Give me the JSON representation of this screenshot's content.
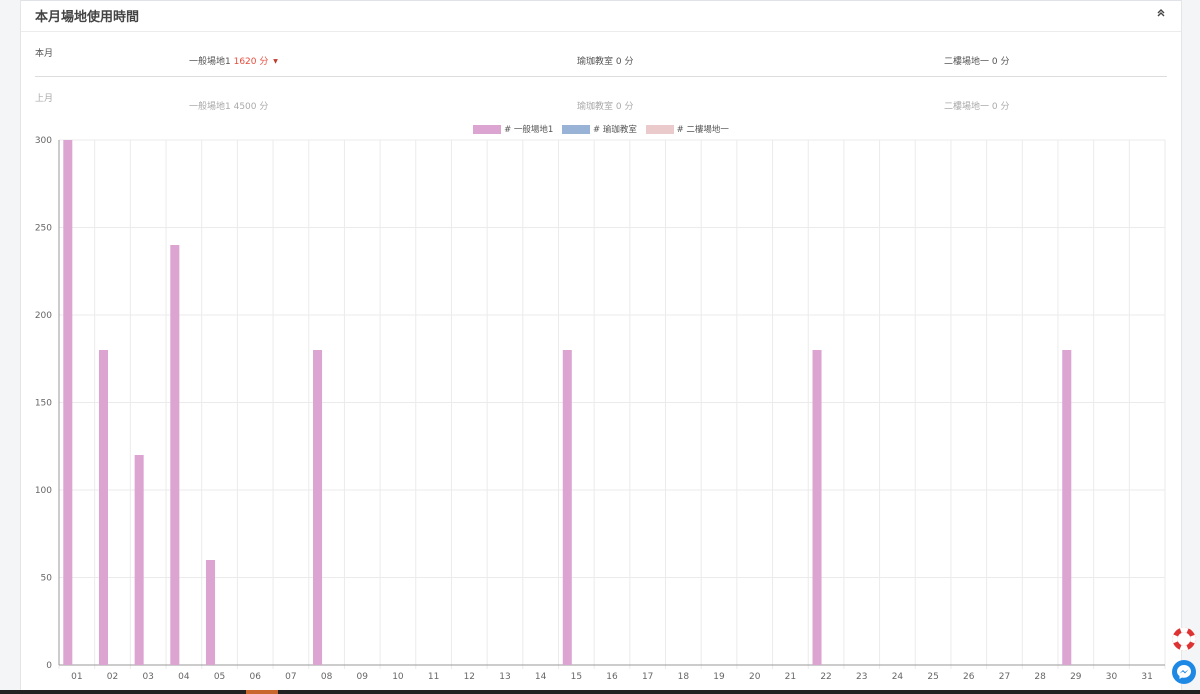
{
  "panel": {
    "title": "本月場地使用時間",
    "collapse_icon": "double-chevron-up-icon"
  },
  "current": {
    "label": "本月",
    "stats": [
      {
        "name": "一般場地1",
        "value": "1620 分",
        "highlight": true,
        "caret": "▼"
      },
      {
        "name": "瑜珈教室",
        "value": "0 分",
        "highlight": false
      },
      {
        "name": "二樓場地一",
        "value": "0 分",
        "highlight": false
      }
    ]
  },
  "previous": {
    "label": "上月",
    "stats": [
      {
        "name": "一般場地1",
        "value": "4500 分"
      },
      {
        "name": "瑜珈教室",
        "value": "0 分"
      },
      {
        "name": "二樓場地一",
        "value": "0 分"
      }
    ]
  },
  "colors": {
    "series1": "#dca4d1",
    "series2": "#98b3d6",
    "series3": "#eacaca",
    "highlight": "#e74c3c",
    "grid": "#ebebeb"
  },
  "chart_data": {
    "type": "bar",
    "categories": [
      "01",
      "02",
      "03",
      "04",
      "05",
      "06",
      "07",
      "08",
      "09",
      "10",
      "11",
      "12",
      "13",
      "14",
      "15",
      "16",
      "17",
      "18",
      "19",
      "20",
      "21",
      "22",
      "23",
      "24",
      "25",
      "26",
      "27",
      "28",
      "29",
      "30",
      "31"
    ],
    "series": [
      {
        "name": "# 一般場地1",
        "values": [
          300,
          180,
          120,
          240,
          60,
          0,
          0,
          180,
          0,
          0,
          0,
          0,
          0,
          0,
          180,
          0,
          0,
          0,
          0,
          0,
          0,
          180,
          0,
          0,
          0,
          0,
          0,
          0,
          180,
          0,
          0
        ]
      },
      {
        "name": "# 瑜珈教室",
        "values": [
          0,
          0,
          0,
          0,
          0,
          0,
          0,
          0,
          0,
          0,
          0,
          0,
          0,
          0,
          0,
          0,
          0,
          0,
          0,
          0,
          0,
          0,
          0,
          0,
          0,
          0,
          0,
          0,
          0,
          0,
          0
        ]
      },
      {
        "name": "# 二樓場地一",
        "values": [
          0,
          0,
          0,
          0,
          0,
          0,
          0,
          0,
          0,
          0,
          0,
          0,
          0,
          0,
          0,
          0,
          0,
          0,
          0,
          0,
          0,
          0,
          0,
          0,
          0,
          0,
          0,
          0,
          0,
          0,
          0
        ]
      }
    ],
    "ylim": [
      0,
      300
    ],
    "yticks": [
      "0",
      "50",
      "100",
      "150",
      "200",
      "250",
      "300"
    ],
    "grid": true,
    "legend": "top-center"
  }
}
